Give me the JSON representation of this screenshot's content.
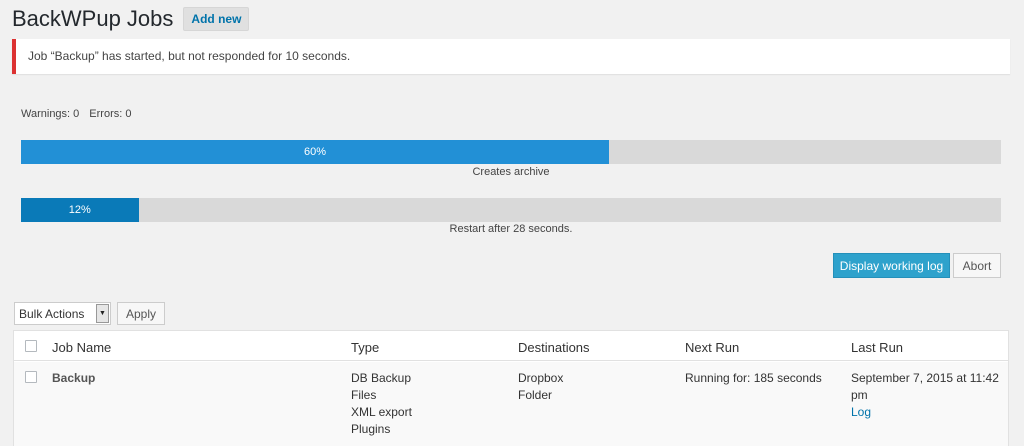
{
  "header": {
    "title": "BackWPup Jobs",
    "add_new": "Add new"
  },
  "notice": {
    "text": "Job “Backup” has started, but not responded for 10 seconds."
  },
  "counters": {
    "warnings": "Warnings: 0",
    "errors": "Errors: 0"
  },
  "progress": [
    {
      "label": "60%",
      "value": 60,
      "caption": "Creates archive"
    },
    {
      "label": "12%",
      "value": 12,
      "caption": "Restart after 28 seconds."
    }
  ],
  "actions": {
    "display_log": "Display working log",
    "abort": "Abort"
  },
  "bulk": {
    "selected": "Bulk Actions",
    "apply": "Apply"
  },
  "table": {
    "columns": [
      "Job Name",
      "Type",
      "Destinations",
      "Next Run",
      "Last Run"
    ],
    "rows": [
      {
        "name": "Backup",
        "types": [
          "DB Backup",
          "Files",
          "XML export",
          "Plugins"
        ],
        "destinations": [
          "Dropbox",
          "Folder"
        ],
        "next_run": "Running for: 185 seconds",
        "last_run": "September 7, 2015 at 11:42 pm",
        "log": "Log"
      }
    ]
  },
  "colors": {
    "bar1": "#2290d6",
    "bar2": "#0a7ab8",
    "notice_border": "#dc3232",
    "link": "#0073aa"
  }
}
